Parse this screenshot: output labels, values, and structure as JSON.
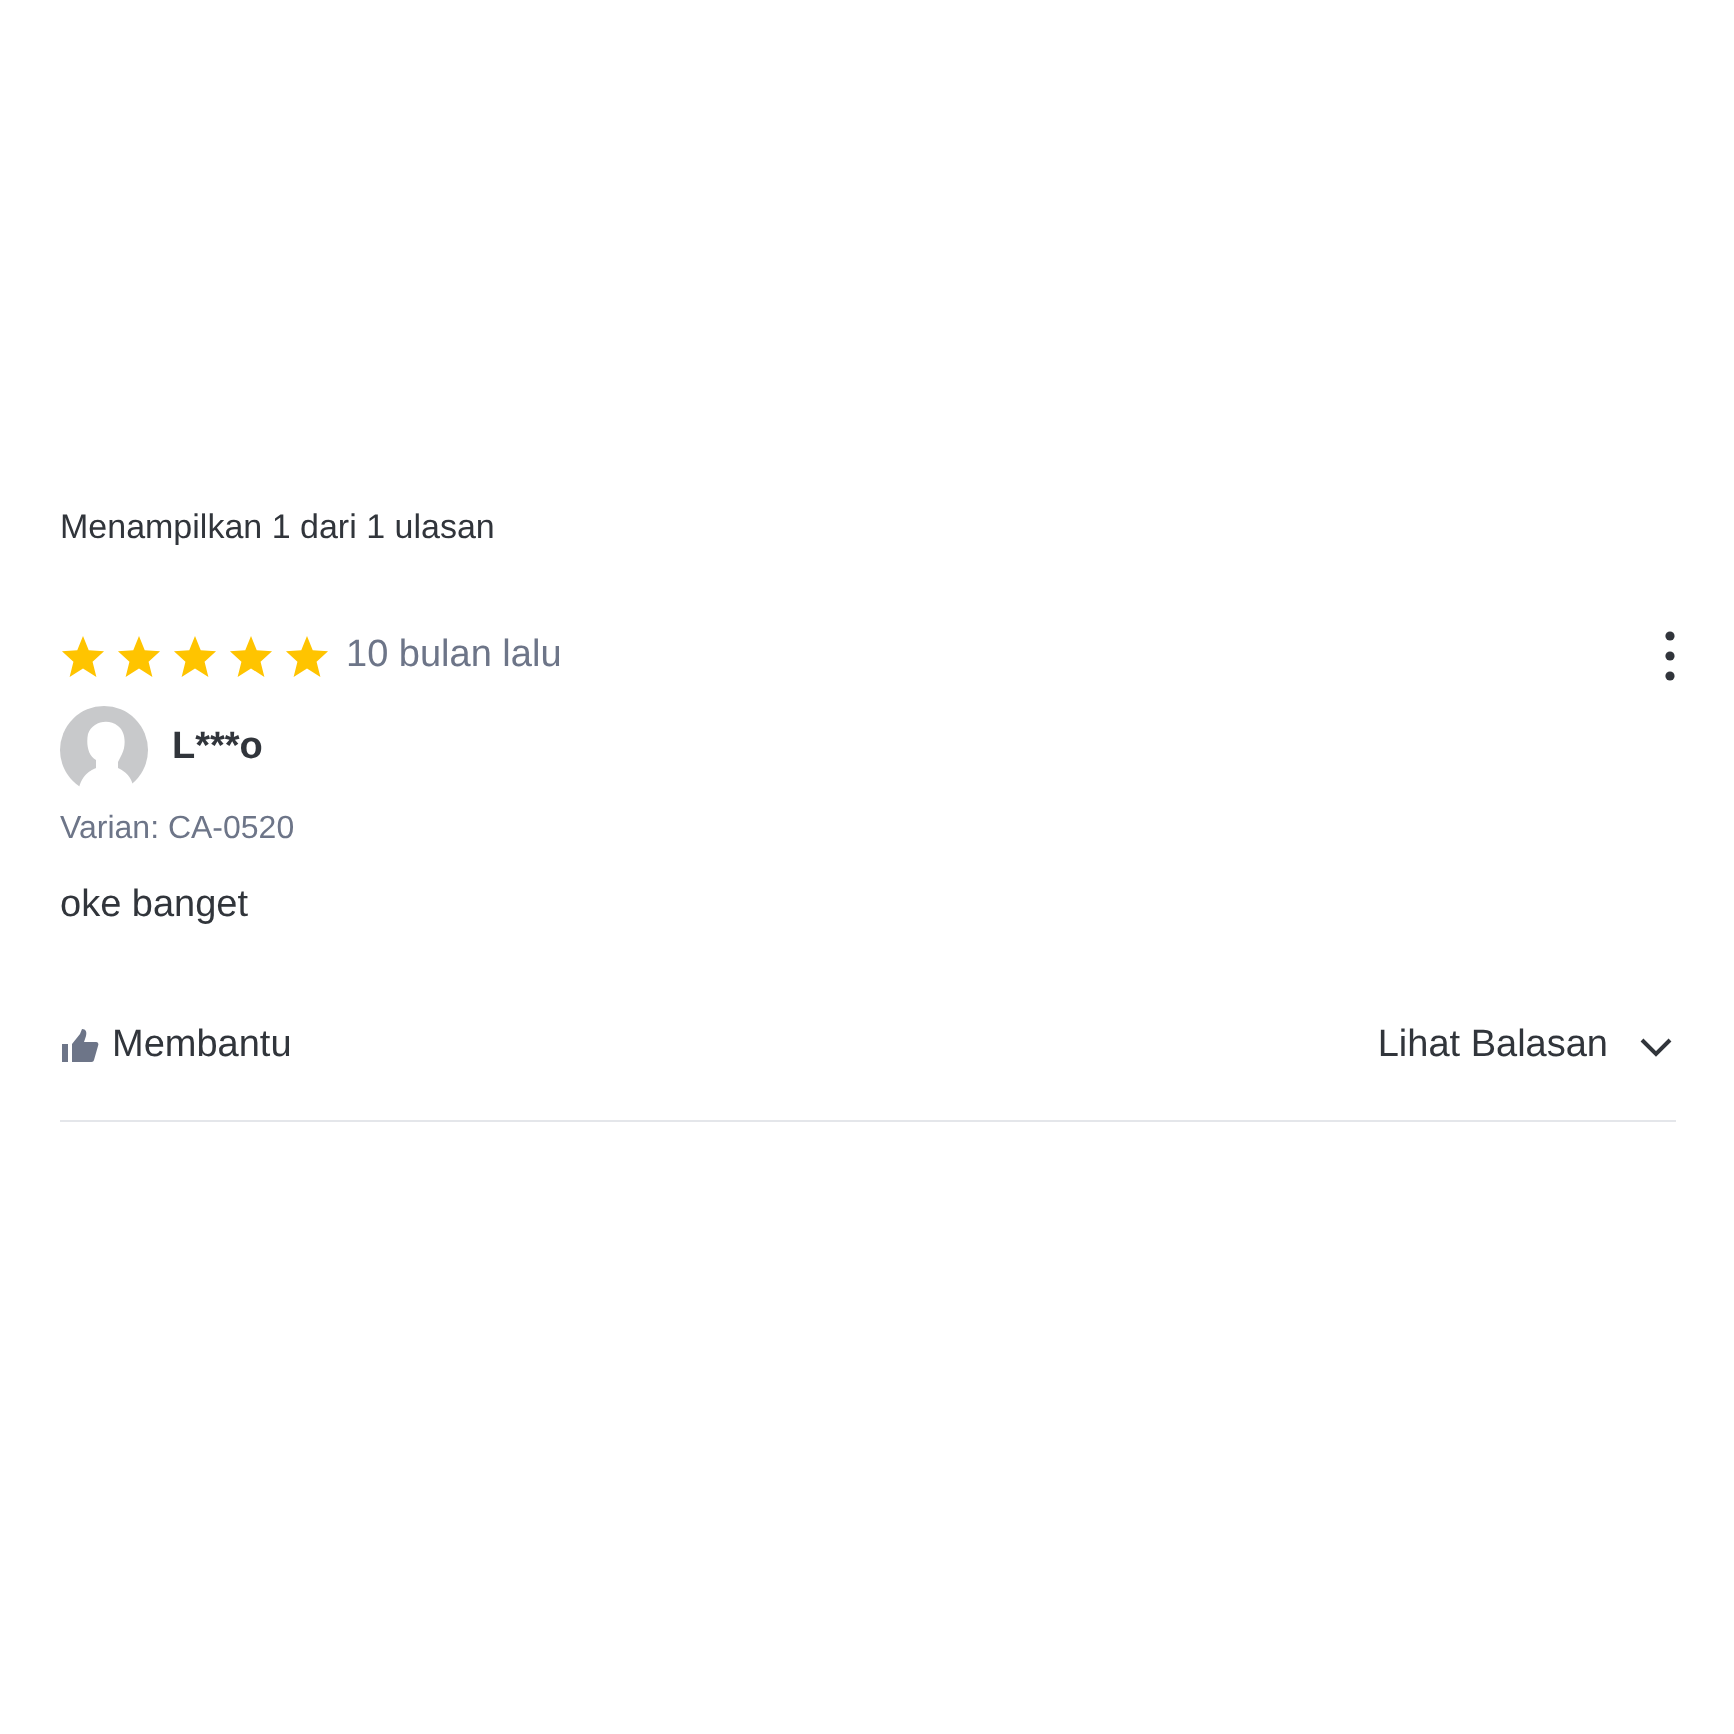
{
  "summary": "Menampilkan 1 dari 1 ulasan",
  "review": {
    "stars": 5,
    "time": "10 bulan lalu",
    "user": "L***o",
    "variant": "Varian: CA-0520",
    "text": "oke banget"
  },
  "actions": {
    "helpful": "Membantu",
    "replies": "Lihat Balasan"
  }
}
